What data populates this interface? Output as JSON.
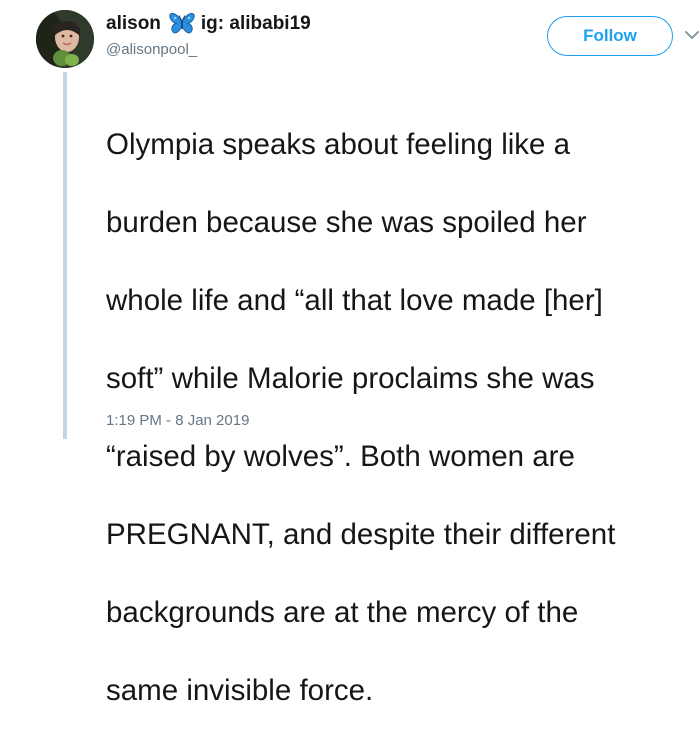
{
  "user": {
    "display_name": "alison",
    "display_name_suffix": "ig: alibabi19",
    "handle": "@alisonpool_",
    "badge_icon": "butterfly-icon"
  },
  "follow_button": {
    "label": "Follow"
  },
  "menu": {
    "icon": "chevron-down-icon"
  },
  "tweet": {
    "text_lines": [
      "Olympia speaks about feeling like a",
      "burden because she was spoiled her",
      "whole life and “all that love made [her]",
      "soft” while Malorie proclaims she was",
      "“raised by wolves”. Both women are",
      "PREGNANT, and despite their different",
      "backgrounds are at the mercy of the",
      "same invisible force."
    ],
    "timestamp": "1:19 PM - 8 Jan 2019"
  },
  "colors": {
    "accent": "#1da1f2",
    "text": "#14171a",
    "secondary_text": "#657786",
    "thread_line": "#c4d6e2",
    "butterfly": "#2b8fe0"
  }
}
